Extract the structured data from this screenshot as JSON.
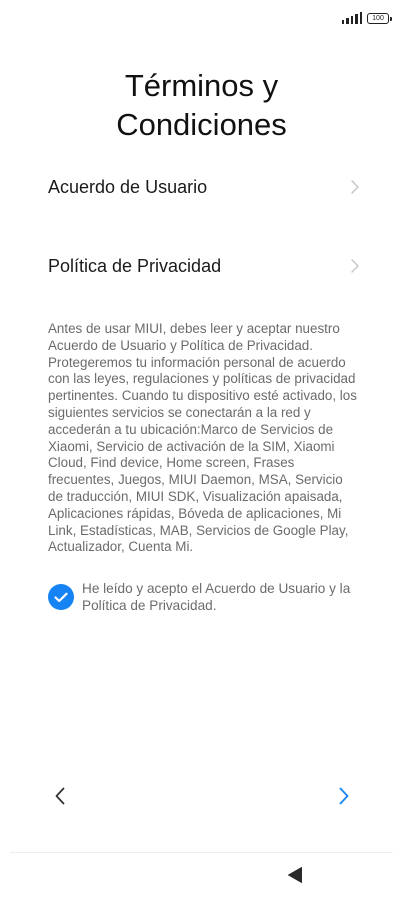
{
  "status_bar": {
    "signal_icon": "signal-bars-icon",
    "battery_level": "100"
  },
  "header": {
    "title": "Términos y\nCondiciones"
  },
  "menu": {
    "items": [
      {
        "label": "Acuerdo de Usuario",
        "icon": "chevron-right-icon"
      },
      {
        "label": "Política de Privacidad",
        "icon": "chevron-right-icon"
      }
    ]
  },
  "body": {
    "text": "Antes de usar MIUI, debes leer y aceptar nuestro Acuerdo de Usuario y Política de Privacidad. Protegeremos tu información personal de acuerdo con las leyes, regulaciones y políticas de privacidad pertinentes. Cuando tu dispositivo esté activado, los siguientes servicios se conectarán a la red y accederán a tu ubicación:Marco de Servicios de Xiaomi, Servicio de activación de la SIM, Xiaomi Cloud, Find device, Home screen, Frases frecuentes, Juegos, MIUI Daemon, MSA, Servicio de traducción, MIUI SDK, Visualización apaisada, Aplicaciones rápidas, Bóveda de aplicaciones, Mi Link, Estadísticas, MAB, Servicios de Google Play, Actualizador, Cuenta Mi."
  },
  "consent": {
    "checked": true,
    "label": "He leído y acepto el Acuerdo de Usuario y la Política de Privacidad."
  },
  "navigation": {
    "back_icon": "chevron-left-icon",
    "next_icon": "chevron-right-icon",
    "system_back_icon": "triangle-back-icon"
  },
  "colors": {
    "accent": "#1683f5",
    "text_primary": "#1a1a1a",
    "text_secondary": "#6b6b6b",
    "chevron_muted": "#c4c4c4",
    "background": "#ffffff"
  }
}
